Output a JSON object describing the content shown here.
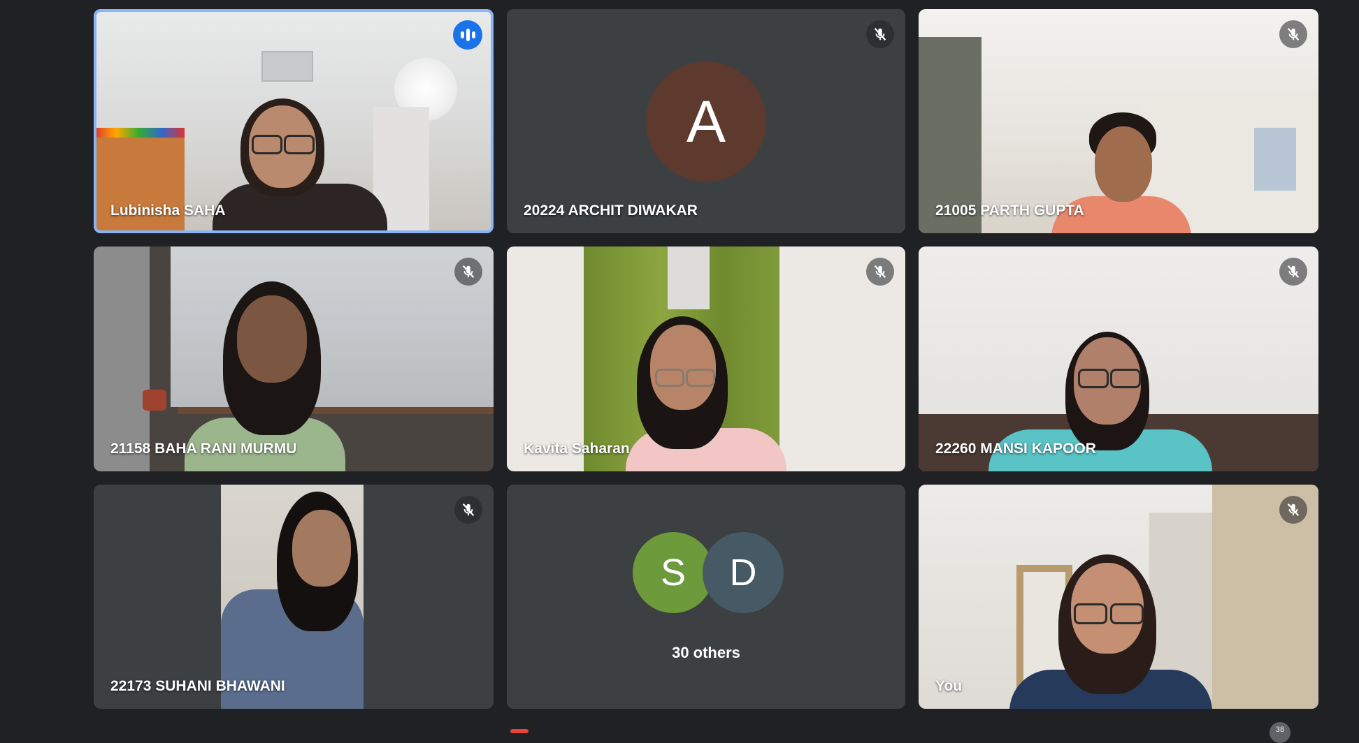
{
  "participants": [
    {
      "name": "Lubinisha SAHA",
      "speaking": true
    },
    {
      "name": "20224 ARCHIT DIWAKAR",
      "avatar_letter": "A",
      "avatar_color": "#5d3a2d",
      "muted": true
    },
    {
      "name": "21005 PARTH GUPTA",
      "muted": true
    },
    {
      "name": "21158 BAHA RANI MURMU",
      "muted": true
    },
    {
      "name": "Kavita Saharan",
      "muted": true
    },
    {
      "name": "22260 MANSI KAPOOR",
      "muted": true
    },
    {
      "name": "22173 SUHANI BHAWANI",
      "muted": true
    },
    {
      "name": "",
      "others_label": "30 others",
      "avatars": [
        {
          "letter": "S",
          "color": "#6d9a3a"
        },
        {
          "letter": "D",
          "color": "#455a64"
        }
      ]
    },
    {
      "name": "You",
      "muted": true
    }
  ],
  "colors": {
    "background": "#202124",
    "tile": "#3c4043",
    "active_border": "#8ab4f8",
    "speaking_badge": "#1a73e8"
  },
  "icons": {
    "mic_off": "mic-off-icon",
    "speaking": "audio-level-icon"
  },
  "footer": {
    "participant_count_badge": "38"
  }
}
